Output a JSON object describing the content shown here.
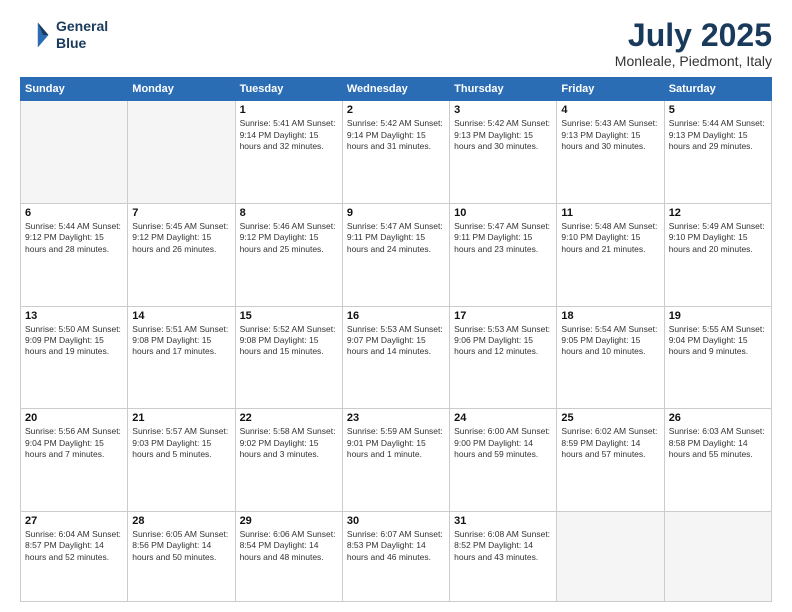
{
  "header": {
    "logo_line1": "General",
    "logo_line2": "Blue",
    "month": "July 2025",
    "location": "Monleale, Piedmont, Italy"
  },
  "days_of_week": [
    "Sunday",
    "Monday",
    "Tuesday",
    "Wednesday",
    "Thursday",
    "Friday",
    "Saturday"
  ],
  "weeks": [
    [
      {
        "num": "",
        "info": ""
      },
      {
        "num": "",
        "info": ""
      },
      {
        "num": "1",
        "info": "Sunrise: 5:41 AM\nSunset: 9:14 PM\nDaylight: 15 hours\nand 32 minutes."
      },
      {
        "num": "2",
        "info": "Sunrise: 5:42 AM\nSunset: 9:14 PM\nDaylight: 15 hours\nand 31 minutes."
      },
      {
        "num": "3",
        "info": "Sunrise: 5:42 AM\nSunset: 9:13 PM\nDaylight: 15 hours\nand 30 minutes."
      },
      {
        "num": "4",
        "info": "Sunrise: 5:43 AM\nSunset: 9:13 PM\nDaylight: 15 hours\nand 30 minutes."
      },
      {
        "num": "5",
        "info": "Sunrise: 5:44 AM\nSunset: 9:13 PM\nDaylight: 15 hours\nand 29 minutes."
      }
    ],
    [
      {
        "num": "6",
        "info": "Sunrise: 5:44 AM\nSunset: 9:12 PM\nDaylight: 15 hours\nand 28 minutes."
      },
      {
        "num": "7",
        "info": "Sunrise: 5:45 AM\nSunset: 9:12 PM\nDaylight: 15 hours\nand 26 minutes."
      },
      {
        "num": "8",
        "info": "Sunrise: 5:46 AM\nSunset: 9:12 PM\nDaylight: 15 hours\nand 25 minutes."
      },
      {
        "num": "9",
        "info": "Sunrise: 5:47 AM\nSunset: 9:11 PM\nDaylight: 15 hours\nand 24 minutes."
      },
      {
        "num": "10",
        "info": "Sunrise: 5:47 AM\nSunset: 9:11 PM\nDaylight: 15 hours\nand 23 minutes."
      },
      {
        "num": "11",
        "info": "Sunrise: 5:48 AM\nSunset: 9:10 PM\nDaylight: 15 hours\nand 21 minutes."
      },
      {
        "num": "12",
        "info": "Sunrise: 5:49 AM\nSunset: 9:10 PM\nDaylight: 15 hours\nand 20 minutes."
      }
    ],
    [
      {
        "num": "13",
        "info": "Sunrise: 5:50 AM\nSunset: 9:09 PM\nDaylight: 15 hours\nand 19 minutes."
      },
      {
        "num": "14",
        "info": "Sunrise: 5:51 AM\nSunset: 9:08 PM\nDaylight: 15 hours\nand 17 minutes."
      },
      {
        "num": "15",
        "info": "Sunrise: 5:52 AM\nSunset: 9:08 PM\nDaylight: 15 hours\nand 15 minutes."
      },
      {
        "num": "16",
        "info": "Sunrise: 5:53 AM\nSunset: 9:07 PM\nDaylight: 15 hours\nand 14 minutes."
      },
      {
        "num": "17",
        "info": "Sunrise: 5:53 AM\nSunset: 9:06 PM\nDaylight: 15 hours\nand 12 minutes."
      },
      {
        "num": "18",
        "info": "Sunrise: 5:54 AM\nSunset: 9:05 PM\nDaylight: 15 hours\nand 10 minutes."
      },
      {
        "num": "19",
        "info": "Sunrise: 5:55 AM\nSunset: 9:04 PM\nDaylight: 15 hours\nand 9 minutes."
      }
    ],
    [
      {
        "num": "20",
        "info": "Sunrise: 5:56 AM\nSunset: 9:04 PM\nDaylight: 15 hours\nand 7 minutes."
      },
      {
        "num": "21",
        "info": "Sunrise: 5:57 AM\nSunset: 9:03 PM\nDaylight: 15 hours\nand 5 minutes."
      },
      {
        "num": "22",
        "info": "Sunrise: 5:58 AM\nSunset: 9:02 PM\nDaylight: 15 hours\nand 3 minutes."
      },
      {
        "num": "23",
        "info": "Sunrise: 5:59 AM\nSunset: 9:01 PM\nDaylight: 15 hours\nand 1 minute."
      },
      {
        "num": "24",
        "info": "Sunrise: 6:00 AM\nSunset: 9:00 PM\nDaylight: 14 hours\nand 59 minutes."
      },
      {
        "num": "25",
        "info": "Sunrise: 6:02 AM\nSunset: 8:59 PM\nDaylight: 14 hours\nand 57 minutes."
      },
      {
        "num": "26",
        "info": "Sunrise: 6:03 AM\nSunset: 8:58 PM\nDaylight: 14 hours\nand 55 minutes."
      }
    ],
    [
      {
        "num": "27",
        "info": "Sunrise: 6:04 AM\nSunset: 8:57 PM\nDaylight: 14 hours\nand 52 minutes."
      },
      {
        "num": "28",
        "info": "Sunrise: 6:05 AM\nSunset: 8:56 PM\nDaylight: 14 hours\nand 50 minutes."
      },
      {
        "num": "29",
        "info": "Sunrise: 6:06 AM\nSunset: 8:54 PM\nDaylight: 14 hours\nand 48 minutes."
      },
      {
        "num": "30",
        "info": "Sunrise: 6:07 AM\nSunset: 8:53 PM\nDaylight: 14 hours\nand 46 minutes."
      },
      {
        "num": "31",
        "info": "Sunrise: 6:08 AM\nSunset: 8:52 PM\nDaylight: 14 hours\nand 43 minutes."
      },
      {
        "num": "",
        "info": ""
      },
      {
        "num": "",
        "info": ""
      }
    ]
  ]
}
